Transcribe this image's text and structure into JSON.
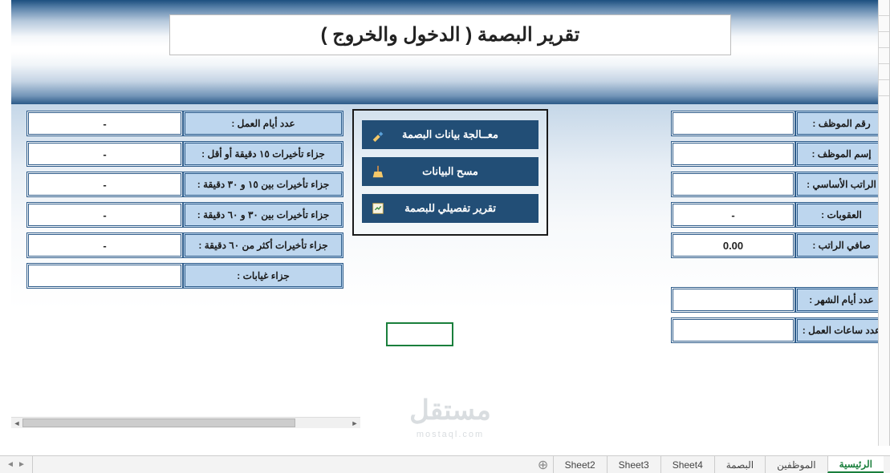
{
  "title": "تقرير البصمة ( الدخول والخروج )",
  "right_fields": {
    "emp_no": {
      "label": "رقم الموظف :",
      "value": ""
    },
    "emp_name": {
      "label": "إسم الموظف :",
      "value": ""
    },
    "base_salary": {
      "label": "الراتب الأساسي :",
      "value": ""
    },
    "penalties": {
      "label": "العقوبات :",
      "value": "-"
    },
    "net_salary": {
      "label": "صافي الراتب :",
      "value": "0.00"
    },
    "month_days": {
      "label": "عدد أيام الشهر :",
      "value": ""
    },
    "work_hours": {
      "label": "عدد ساعات العمل :",
      "value": ""
    }
  },
  "left_fields": {
    "work_days": {
      "label": "عدد أيام العمل :",
      "value": "-"
    },
    "late15": {
      "label": "جزاء تأخيرات ١٥ دقيقة أو أقل :",
      "value": "-"
    },
    "late15_30": {
      "label": "جزاء تأخيرات بين ١٥ و ٣٠ دقيقة :",
      "value": "-"
    },
    "late30_60": {
      "label": "جزاء تأخيرات بين ٣٠ و ٦٠ دقيقة :",
      "value": "-"
    },
    "late60": {
      "label": "جزاء تأخيرات أكثر من ٦٠ دقيقة :",
      "value": "-"
    },
    "absences": {
      "label": "جزاء غيابات :",
      "value": ""
    }
  },
  "actions": {
    "process": "معــالجة بيانات البصمة",
    "clear": "مسح البيانات",
    "report": "تقرير تفصيلي للبصمة"
  },
  "tabs": [
    "الرئيسية",
    "الموظفين",
    "البصمة",
    "Sheet4",
    "Sheet3",
    "Sheet2"
  ],
  "active_tab": 0,
  "watermark": "مستقل",
  "watermark_sub": "mostaql.com"
}
